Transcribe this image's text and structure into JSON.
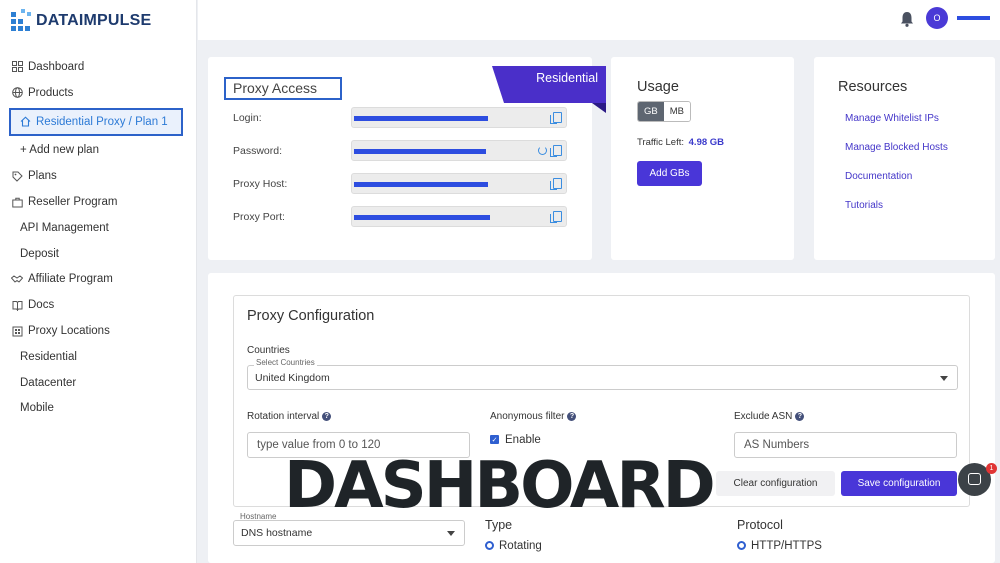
{
  "brand": {
    "name": "DATAIMPULSE"
  },
  "sidebar": {
    "items": [
      {
        "label": "Dashboard",
        "icon": "grid-icon"
      },
      {
        "label": "Products",
        "icon": "globe-icon"
      },
      {
        "label": "Residential Proxy / Plan 1",
        "icon": "home-icon"
      },
      {
        "label": "+ Add new plan"
      },
      {
        "label": "Plans",
        "icon": "tag-icon"
      },
      {
        "label": "Reseller Program",
        "icon": "briefcase-icon"
      },
      {
        "label": "API Management"
      },
      {
        "label": "Deposit"
      },
      {
        "label": "Affiliate Program",
        "icon": "handshake-icon"
      },
      {
        "label": "Docs",
        "icon": "book-icon"
      },
      {
        "label": "Proxy Locations",
        "icon": "building-icon"
      },
      {
        "label": "Residential"
      },
      {
        "label": "Datacenter"
      },
      {
        "label": "Mobile"
      }
    ]
  },
  "topbar": {
    "avatar_initial": "O"
  },
  "proxy_access": {
    "title": "Proxy Access",
    "ribbon": "Residential",
    "fields": [
      {
        "label": "Login:"
      },
      {
        "label": "Password:"
      },
      {
        "label": "Proxy Host:"
      },
      {
        "label": "Proxy Port:"
      }
    ]
  },
  "usage": {
    "title": "Usage",
    "unit_gb": "GB",
    "unit_mb": "MB",
    "traffic_label": "Traffic Left:",
    "traffic_value": "4.98 GB",
    "add_button": "Add GBs"
  },
  "resources": {
    "title": "Resources",
    "links": [
      "Manage Whitelist IPs",
      "Manage Blocked Hosts",
      "Documentation",
      "Tutorials"
    ]
  },
  "config": {
    "title": "Proxy Configuration",
    "countries_label": "Countries",
    "select_countries_label": "Select Countries",
    "country_value": "United Kingdom",
    "rotation_label": "Rotation interval",
    "rotation_placeholder": "type value from 0 to 120",
    "anonymous_label": "Anonymous filter",
    "enable_label": "Enable",
    "exclude_asn_label": "Exclude ASN",
    "asn_placeholder": "AS Numbers",
    "clear_button": "Clear configuration",
    "save_button": "Save configuration",
    "hostname_label": "Hostname",
    "hostname_value": "DNS hostname",
    "type_label": "Type",
    "type_value": "Rotating",
    "protocol_label": "Protocol",
    "protocol_value": "HTTP/HTTPS"
  },
  "overlay_text": "DASHBOARD",
  "chat": {
    "badge_count": "1"
  },
  "colors": {
    "accent": "#4936d8",
    "highlight": "#2c62c9",
    "redaction": "#2d4de0"
  }
}
